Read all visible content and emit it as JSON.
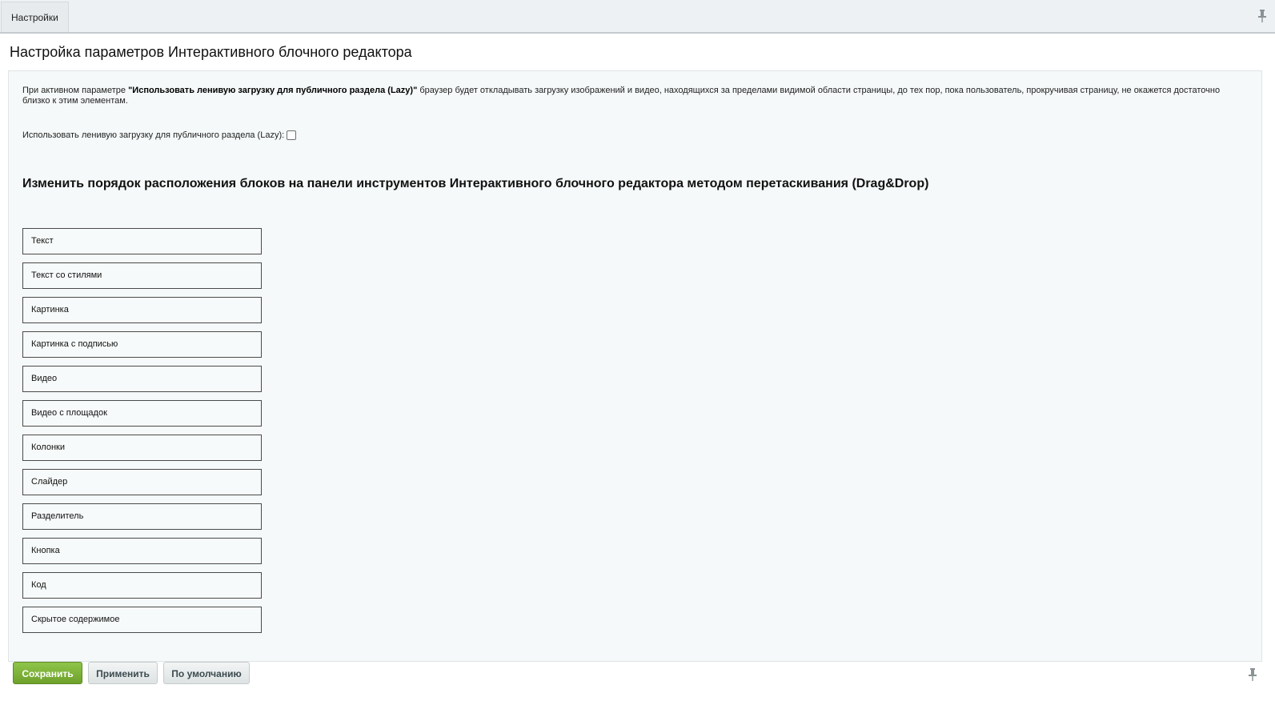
{
  "tabs": {
    "active_label": "Настройки"
  },
  "page": {
    "title": "Настройка параметров Интерактивного блочного редактора"
  },
  "notice": {
    "prefix": "При активном параметре ",
    "option_name": "\"Использовать ленивую загрузку для публичного раздела (Lazy)\"",
    "suffix": " браузер будет откладывать загрузку изображений и видео, находящихся за пределами видимой области страницы, до тех пор, пока пользователь, прокручивая страницу, не окажется достаточно близко к этим элементам."
  },
  "lazy_option": {
    "label": "Использовать ленивую загрузку для публичного раздела (Lazy):",
    "checked": false
  },
  "blocks_section": {
    "title": "Изменить порядок расположения блоков на панели инструментов Интерактивного блочного редактора методом перетаскивания (Drag&Drop)",
    "items": [
      "Текст",
      "Текст со стилями",
      "Картинка",
      "Картинка с подписью",
      "Видео",
      "Видео с площадок",
      "Колонки",
      "Слайдер",
      "Разделитель",
      "Кнопка",
      "Код",
      "Скрытое содержимое"
    ]
  },
  "buttons": {
    "save": "Сохранить",
    "apply": "Применить",
    "default": "По умолчанию"
  },
  "colors": {
    "save_button": "#7ab332",
    "panel_background": "#f5f9f9"
  },
  "icons": {
    "pin": "pin-icon"
  }
}
